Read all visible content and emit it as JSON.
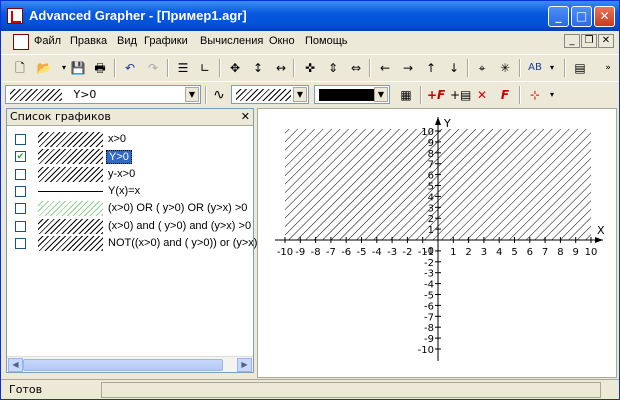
{
  "window": {
    "title": "Advanced Grapher - [Пример1.agr]",
    "minimize": "_",
    "maximize": "□",
    "close": "✕"
  },
  "menu": {
    "items": [
      "Файл",
      "Правка",
      "Вид",
      "Графики",
      "Вычисления",
      "Окно",
      "Помощь"
    ]
  },
  "toolbar2": {
    "graph_combo": "Y>0",
    "shortcut_ab": "AB"
  },
  "panel": {
    "title": "Список графиков",
    "close": "✕",
    "items": [
      {
        "label": "x>0",
        "checked": false,
        "style": "hatch"
      },
      {
        "label": "Y>0",
        "checked": true,
        "style": "hatch",
        "selected": true
      },
      {
        "label": "y-x>0",
        "checked": false,
        "style": "hatch"
      },
      {
        "label": "Y(x)=x",
        "checked": false,
        "style": "line"
      },
      {
        "label": "(x>0) OR ( y>0)  OR  (y>x)  >0",
        "checked": false,
        "style": "hatch-green"
      },
      {
        "label": "(x>0) and ( y>0)  and  (y>x)  >0",
        "checked": false,
        "style": "hatch"
      },
      {
        "label": "NOT((x>0) and ( y>0))  or  (y>x)",
        "checked": false,
        "style": "hatch"
      }
    ]
  },
  "plot": {
    "x_axis_label": "X",
    "y_axis_label": "Y",
    "xmin": -10,
    "xmax": 10,
    "ymin": -10,
    "ymax": 10,
    "shaded_region": "Y>0"
  },
  "status": {
    "text": "Готов"
  }
}
